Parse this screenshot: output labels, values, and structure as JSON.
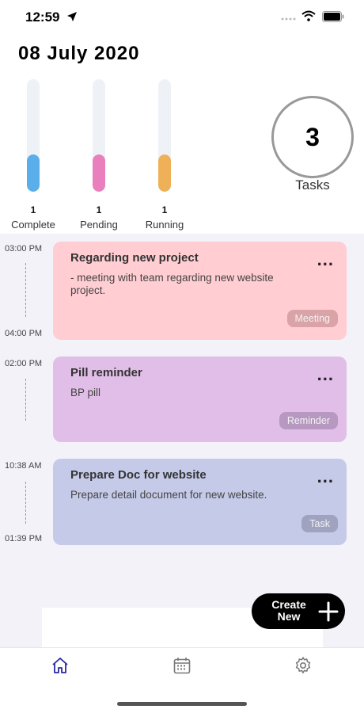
{
  "status_bar": {
    "time": "12:59",
    "icons": [
      "location-arrow-icon",
      "signal-dots-icon",
      "wifi-icon",
      "battery-icon"
    ]
  },
  "header": {
    "date": "08 July 2020"
  },
  "stats": [
    {
      "label": "Complete",
      "count": "1",
      "color": "#5aaeea",
      "fill_fraction": 0.33
    },
    {
      "label": "Pending",
      "count": "1",
      "color": "#e97fbd",
      "fill_fraction": 0.33
    },
    {
      "label": "Running",
      "count": "1",
      "color": "#eeb158",
      "fill_fraction": 0.33
    }
  ],
  "tasks_total": {
    "count": "3",
    "label": "Tasks"
  },
  "schedule": [
    {
      "start": "03:00 PM",
      "end": "04:00 PM",
      "title": "Regarding new project",
      "description": "- meeting with team regarding new website project.",
      "tag": "Meeting",
      "color": "#ffcdd2",
      "tag_color": "#d9a3a8"
    },
    {
      "start": "02:00 PM",
      "end": "",
      "title": "Pill reminder",
      "description": "BP pill",
      "tag": "Reminder",
      "color": "#e1bee7",
      "tag_color": "#b798c0"
    },
    {
      "start": "10:38 AM",
      "end": "01:39 PM",
      "title": "Prepare Doc for website",
      "description": "Prepare detail document for new website.",
      "tag": "Task",
      "color": "#c5cae9",
      "tag_color": "#9fa3bf"
    }
  ],
  "fab": {
    "line1": "Create",
    "line2": "New",
    "icon": "plus-icon"
  },
  "nav": [
    {
      "name": "home",
      "icon": "home-icon",
      "active": true,
      "color": "#2a2aa0"
    },
    {
      "name": "calendar",
      "icon": "calendar-icon",
      "active": false,
      "color": "#777777"
    },
    {
      "name": "settings",
      "icon": "gear-icon",
      "active": false,
      "color": "#777777"
    }
  ],
  "more_label": "..."
}
